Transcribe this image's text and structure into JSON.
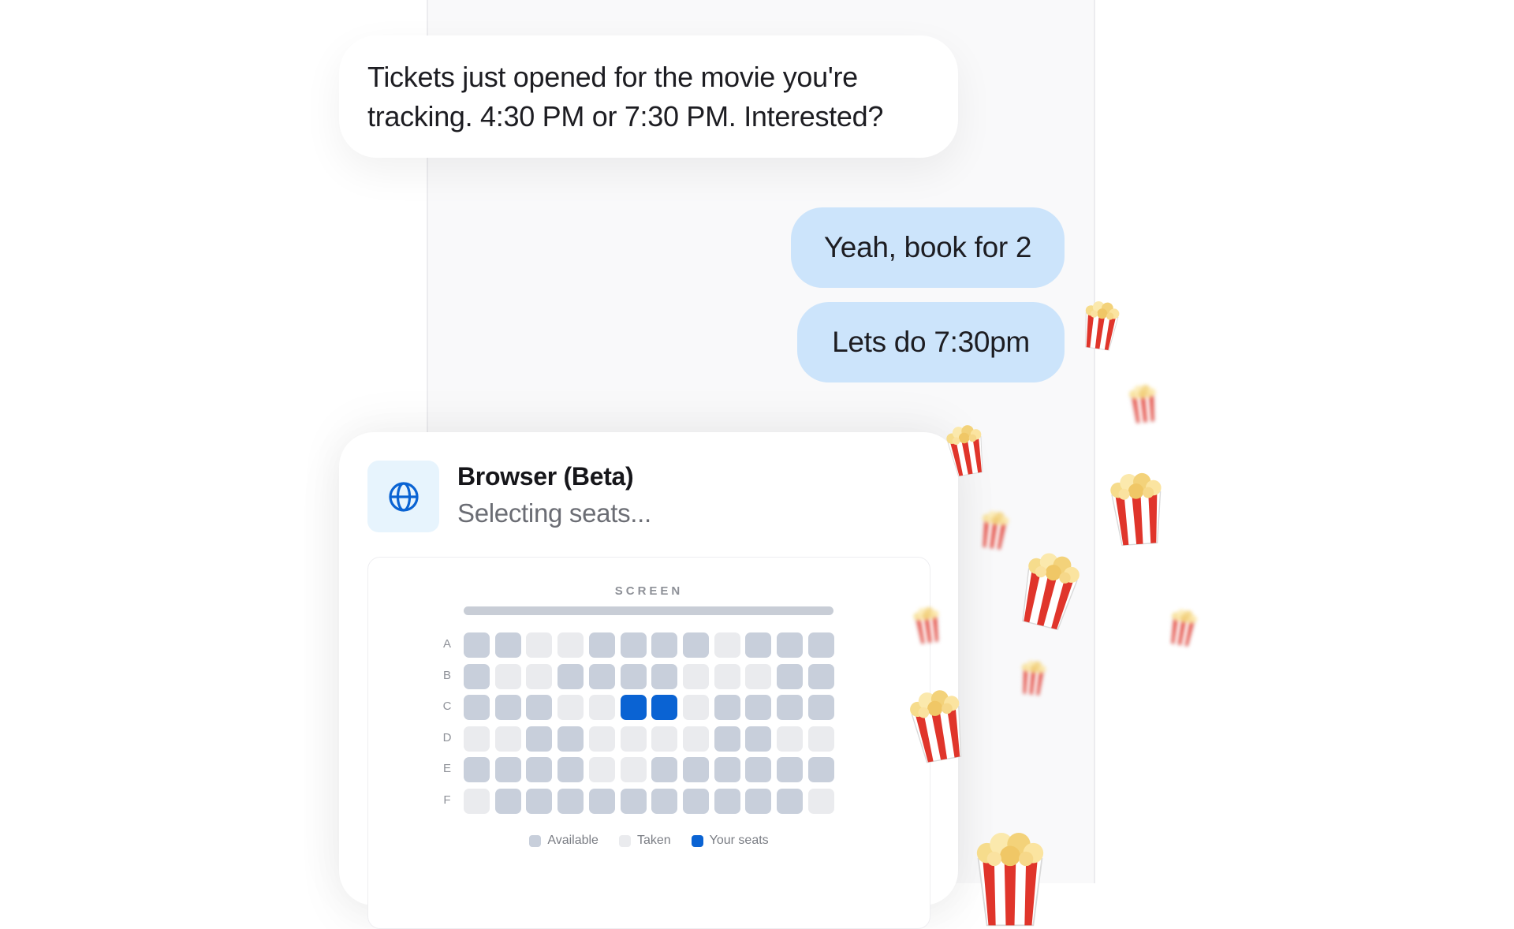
{
  "messages": {
    "incoming": "Tickets just opened for the movie you're tracking. 4:30 PM or 7:30 PM. Interested?",
    "outgoing": [
      "Yeah, book for 2",
      "Lets do 7:30pm"
    ]
  },
  "browser_card": {
    "title": "Browser (Beta)",
    "status": "Selecting seats...",
    "icon": "globe-icon",
    "seat_map": {
      "screen_label": "SCREEN",
      "rows": [
        {
          "label": "A",
          "seats": [
            "available",
            "available",
            "taken",
            "taken",
            "available",
            "available",
            "available",
            "available",
            "taken",
            "available",
            "available",
            "available"
          ]
        },
        {
          "label": "B",
          "seats": [
            "available",
            "taken",
            "taken",
            "available",
            "available",
            "available",
            "available",
            "taken",
            "taken",
            "taken",
            "available",
            "available"
          ]
        },
        {
          "label": "C",
          "seats": [
            "available",
            "available",
            "available",
            "taken",
            "taken",
            "mine",
            "mine",
            "taken",
            "available",
            "available",
            "available",
            "available"
          ]
        },
        {
          "label": "D",
          "seats": [
            "taken",
            "taken",
            "available",
            "available",
            "taken",
            "taken",
            "taken",
            "taken",
            "available",
            "available",
            "taken",
            "taken"
          ]
        },
        {
          "label": "E",
          "seats": [
            "available",
            "available",
            "available",
            "available",
            "taken",
            "taken",
            "available",
            "available",
            "available",
            "available",
            "available",
            "available"
          ]
        },
        {
          "label": "F",
          "seats": [
            "taken",
            "available",
            "available",
            "available",
            "available",
            "available",
            "available",
            "available",
            "available",
            "available",
            "available",
            "taken"
          ]
        }
      ],
      "legend": [
        {
          "label": "Available",
          "status": "available",
          "color": "#c8cfdb"
        },
        {
          "label": "Taken",
          "status": "taken",
          "color": "#eaebee"
        },
        {
          "label": "Your seats",
          "status": "mine",
          "color": "#0a63d3"
        }
      ]
    }
  },
  "colors": {
    "accent": "#0a63d3",
    "outgoing_bubble": "#cce4fb",
    "globe_tile": "#e7f4fd",
    "popcorn_stripe": "#e0352b"
  },
  "decorations": [
    "popcorn-icon"
  ]
}
